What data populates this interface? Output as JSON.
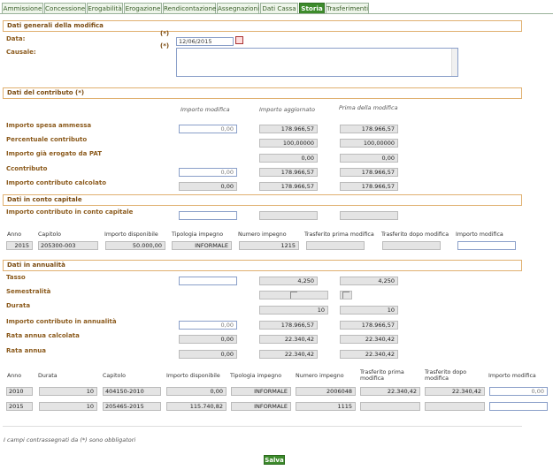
{
  "tabs": [
    "Ammissione",
    "Concessione",
    "Erogabilità",
    "Erogazione",
    "Rendicontazione",
    "Assegnazioni",
    "Dati Cassa",
    "Storia",
    "Trasferimenti"
  ],
  "active_tab": "Storia",
  "generali": {
    "title": "Dati generali della modifica",
    "data_label": "Data:",
    "required_mark": "(*)",
    "data_value": "12/06/2015",
    "causale_label": "Causale:"
  },
  "contributo": {
    "title": "Dati del contributo (*)",
    "col_modifica": "Importo modifica",
    "col_aggiornato": "Importo aggiornato",
    "col_prima": "Prima della modifica",
    "rows": [
      {
        "label": "Importo spesa ammessa",
        "modifica": "0,00",
        "aggiornato": "178.966,57",
        "prima": "178.966,57"
      },
      {
        "label": "Percentuale contributo",
        "modifica": "",
        "aggiornato": "100,00000",
        "prima": "100,00000"
      },
      {
        "label": "Importo già erogato da PAT",
        "modifica": "",
        "aggiornato": "0,00",
        "prima": "0,00"
      },
      {
        "label": "Ccontributo",
        "modifica": "0,00",
        "aggiornato": "178.966,57",
        "prima": "178.966,57"
      },
      {
        "label": "Importo contributo calcolato",
        "modifica": "0,00",
        "aggiornato": "178.966,57",
        "prima": "178.966,57"
      }
    ]
  },
  "capitale": {
    "title": "Dati in conto capitale",
    "label": "Importo contributo in conto capitale",
    "headers": [
      "Anno",
      "Capitolo",
      "Importo disponibile",
      "Tipologia impegno",
      "Numero impegno",
      "Trasferito prima modifica",
      "Trasferito dopo modifica",
      "Importo modifica"
    ],
    "row": [
      "2015",
      "205300-003",
      "50.000,00",
      "INFORMALE",
      "1215",
      "",
      "",
      ""
    ]
  },
  "annualita": {
    "title": "Dati in annualità",
    "rows": [
      {
        "label": "Tasso",
        "modifica": "",
        "aggiornato": "4,250",
        "prima": "4,250"
      },
      {
        "label": "Semestralità",
        "modifica": "",
        "aggiornato": "",
        "prima": ""
      },
      {
        "label": "Durata",
        "modifica": "",
        "aggiornato": "10",
        "prima": "10"
      },
      {
        "label": "Importo contributo in annualità",
        "modifica": "0,00",
        "aggiornato": "178.966,57",
        "prima": "178.966,57"
      },
      {
        "label": "Rata annua calcolata",
        "modifica": "0,00",
        "aggiornato": "22.340,42",
        "prima": "22.340,42"
      },
      {
        "label": "Rata annua",
        "modifica": "0,00",
        "aggiornato": "22.340,42",
        "prima": "22.340,42"
      }
    ],
    "headers": [
      "Anno",
      "Durata",
      "Capitolo",
      "Importo disponibile",
      "Tipologia impegno",
      "Numero impegno",
      "Trasferito prima modifica",
      "Trasferito dopo modifica",
      "Importo modifica"
    ],
    "table": [
      [
        "2010",
        "10",
        "404150-2010",
        "0,00",
        "INFORMALE",
        "2006048",
        "22.340,42",
        "22.340,42",
        "0,00"
      ],
      [
        "2015",
        "10",
        "205465-2015",
        "115.740,82",
        "INFORMALE",
        "1115",
        "",
        "",
        ""
      ]
    ]
  },
  "footer_note": "I campi contrassegnati da (*) sono obbligatori",
  "save_label": "Salva",
  "colors": {
    "accent": "#3d8b2c",
    "section_border": "#e0b070",
    "label": "#8b5a1c"
  }
}
